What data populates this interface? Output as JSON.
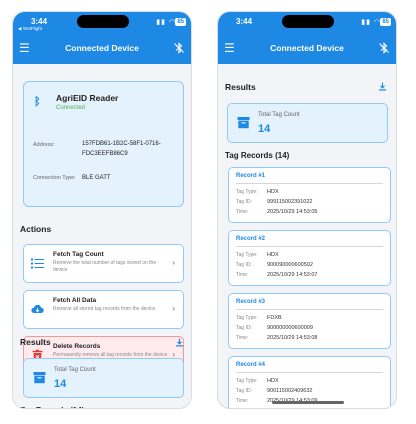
{
  "status_bar": {
    "time": "3:44",
    "back_label": "◀ TestFlight",
    "signal": "▮▮ ◠",
    "battery": "85"
  },
  "app_bar": {
    "title": "Connected Device"
  },
  "device": {
    "name": "AgriEID Reader",
    "status": "Connected",
    "address_label": "Address:",
    "address_value": "157FDB61-1B2C-58F1-0716-FDC3EEFB86C9",
    "connection_label": "Connection Type:",
    "connection_value": "BLE GATT"
  },
  "actions": {
    "heading": "Actions",
    "items": [
      {
        "title": "Fetch Tag Count",
        "desc": "Retrieve the total number of tags stored on the device"
      },
      {
        "title": "Fetch All Data",
        "desc": "Retrieve all stored tag records from the device"
      },
      {
        "title": "Delete Records",
        "desc": "Permanently remove all tag records from the device"
      }
    ]
  },
  "results": {
    "heading": "Results",
    "total_label": "Total Tag Count",
    "total_value": "14",
    "records_heading": "Tag Records (14)"
  },
  "records": [
    {
      "title": "Record #1",
      "type_label": "Tag Type:",
      "type": "HDX",
      "id_label": "Tag ID:",
      "id": "999115002391022",
      "time_label": "Time:",
      "time": "2025/10/29 14:53:05"
    },
    {
      "title": "Record #2",
      "type_label": "Tag Type:",
      "type": "HDX",
      "id_label": "Tag ID:",
      "id": "900090000600502",
      "time_label": "Time:",
      "time": "2025/10/29 14:53:07"
    },
    {
      "title": "Record #3",
      "type_label": "Tag Type:",
      "type": "FDXB",
      "id_label": "Tag ID:",
      "id": "900000000600009",
      "time_label": "Time:",
      "time": "2025/10/29 14:53:08"
    },
    {
      "title": "Record #4",
      "type_label": "Tag Type:",
      "type": "HDX",
      "id_label": "Tag ID:",
      "id": "900115002409632",
      "time_label": "Time:",
      "time": "2025/10/29 14:53:09"
    }
  ],
  "icons": {
    "menu": "menu-icon",
    "disconnect": "bluetooth-disabled-icon",
    "bluetooth": "bluetooth-icon",
    "list": "list-icon",
    "cloud": "cloud-download-icon",
    "trash": "trash-icon",
    "download": "download-icon",
    "archive": "archive-icon"
  },
  "colors": {
    "primary": "#1e88e5",
    "card_bg": "#e3f2fd",
    "danger": "#e53935",
    "danger_bg": "#ffebee",
    "success": "#4caf50"
  }
}
